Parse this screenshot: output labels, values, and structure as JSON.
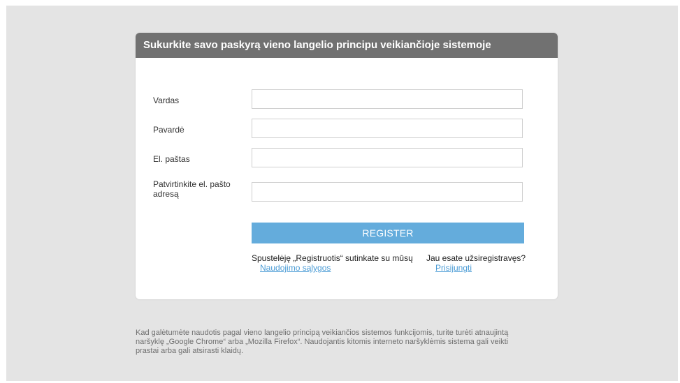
{
  "form": {
    "title": "Sukurkite savo paskyrą vieno langelio principu veikiančioje sistemoje",
    "fields": [
      {
        "label": "Vardas",
        "value": ""
      },
      {
        "label": "Pavardė",
        "value": ""
      },
      {
        "label": "El. paštas",
        "value": ""
      },
      {
        "label_line1": "Patvirtinkite el. pašto",
        "label_line2": "adresą",
        "value": ""
      }
    ],
    "register_label": "REGISTER",
    "terms_text": "Spustelėję „Registruotis“ sutinkate su mūsų",
    "terms_link": "Naudojimo sąlygos",
    "login_text": "Jau esate užsiregistravęs?",
    "login_link": "Prisijungti"
  },
  "footer": {
    "line1": "Kad galėtumėte naudotis pagal vieno langelio principą veikiančios sistemos funkcijomis, turite turėti atnaujintą",
    "line2": "naršyklę „Google Chrome“ arba „Mozilla Firefox“. Naudojantis kitomis interneto naršyklėmis sistema gali veikti",
    "line3": "prastai arba gali atsirasti klaidų."
  },
  "colors": {
    "header_bg": "#717171",
    "button_bg": "#64acdc",
    "link": "#4a9bd5",
    "page_bg": "#e4e4e4"
  }
}
